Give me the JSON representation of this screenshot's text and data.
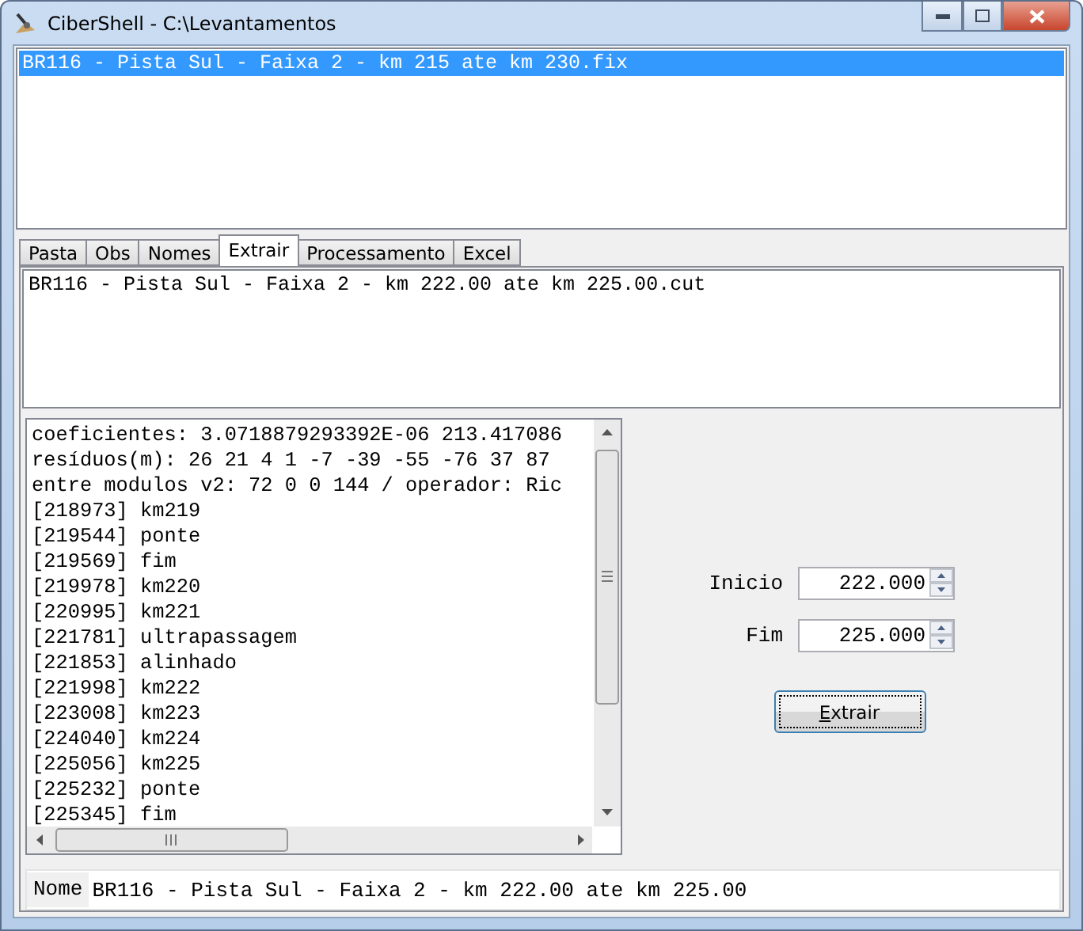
{
  "window": {
    "title": "CiberShell - C:\\Levantamentos"
  },
  "files": [
    {
      "label": "BR116 - Pista Sul - Faixa 2 - km 215 ate km 230.fix",
      "selected": true
    }
  ],
  "tabs": [
    {
      "label": "Pasta",
      "selected": false
    },
    {
      "label": "Obs",
      "selected": false
    },
    {
      "label": "Nomes",
      "selected": false
    },
    {
      "label": "Extrair",
      "selected": true
    },
    {
      "label": "Processamento",
      "selected": false
    },
    {
      "label": "Excel",
      "selected": false
    }
  ],
  "cuts": [
    {
      "label": "BR116 - Pista Sul - Faixa 2 - km 222.00 ate km 225.00.cut",
      "selected": false
    }
  ],
  "log": [
    "coeficientes: 3.0718879293392E-06 213.417086",
    "resíduos(m): 26 21 4 1 -7 -39 -55 -76 37 87",
    "entre modulos v2: 72 0 0 144 / operador: Ric",
    "[218973] km219",
    "[219544] ponte",
    "[219569] fim",
    "[219978] km220",
    "[220995] km221",
    "[221781] ultrapassagem",
    "[221853] alinhado",
    "[221998] km222",
    "[223008] km223",
    "[224040] km224",
    "[225056] km225",
    "[225232] ponte",
    "[225345] fim"
  ],
  "spinners": [
    {
      "label": "Inicio",
      "value": "222.000"
    },
    {
      "label": "Fim",
      "value": "225.000"
    }
  ],
  "extract_button": {
    "label": "Extrair"
  },
  "name_field": {
    "label": "Nome",
    "value": "BR116 - Pista Sul - Faixa 2 - km 222.00 ate km 225.00"
  }
}
